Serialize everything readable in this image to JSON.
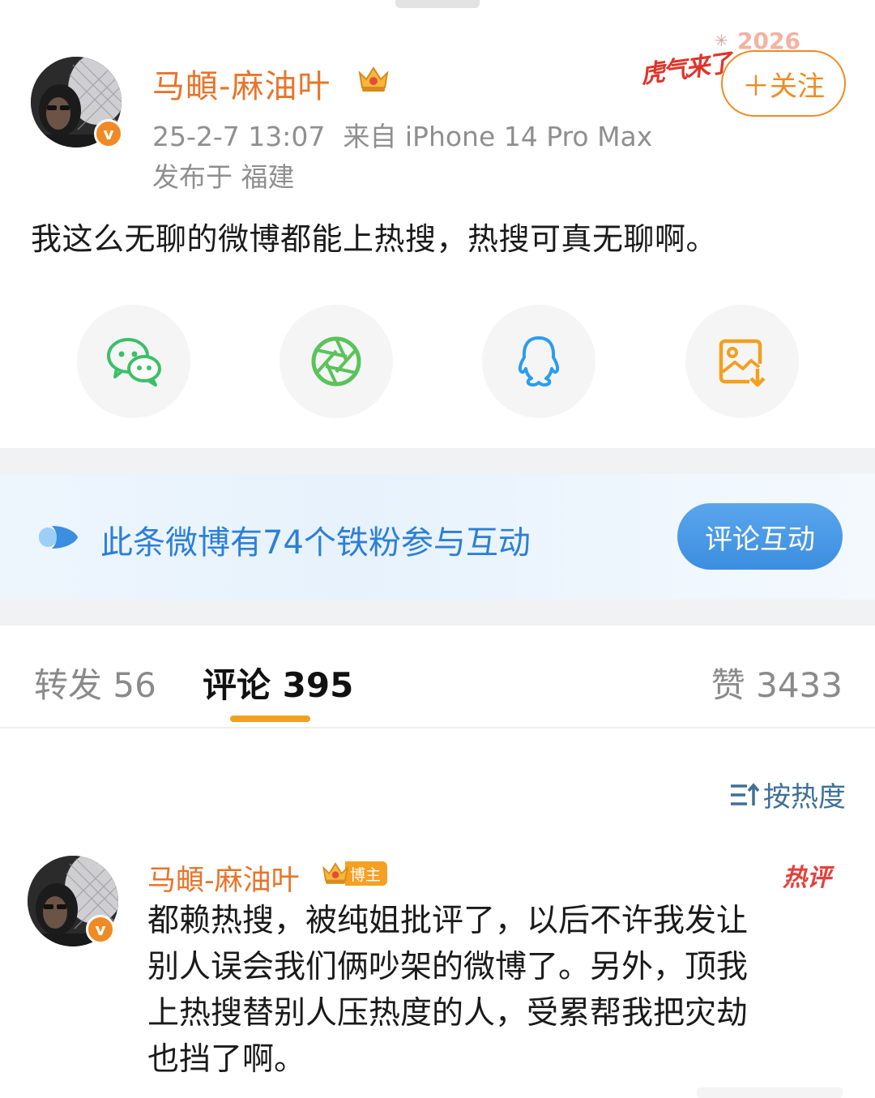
{
  "post": {
    "author_name": "马頔-麻油叶",
    "timestamp": "25-2-7 13:07",
    "source": "来自 iPhone 14 Pro Max",
    "location": "发布于 福建",
    "text": "我这么无聊的微博都能上热搜，热搜可真无聊啊。",
    "stamp": "虎气来了",
    "deco_text": "2026",
    "follow_label": "＋关注"
  },
  "share_buttons": [
    {
      "icon": "wechat-icon",
      "color": "#3cbf6a"
    },
    {
      "icon": "moments-icon",
      "color": "#5ac35a"
    },
    {
      "icon": "qq-icon",
      "color": "#2b9cf2"
    },
    {
      "icon": "save-image-icon",
      "color": "#f2a020"
    }
  ],
  "fans_banner": {
    "text": "此条微博有74个铁粉参与互动",
    "button_label": "评论互动"
  },
  "tabs": {
    "repost": "转发 56",
    "comments": "评论 395",
    "likes": "赞 3433"
  },
  "sort_label": "按热度",
  "comment": {
    "author_name": "马頔-麻油叶",
    "author_tag": "博主",
    "hot_tag": "热评",
    "lines": [
      "都赖热搜，被纯姐批评了，以后不许我发让",
      "别人误会我们俩吵架的微博了。另外，顶我",
      "上热搜替别人压热度的人，受累帮我把灾劫",
      "也挡了啊。"
    ]
  },
  "colors": {
    "accent_orange": "#f08a24",
    "link_blue": "#2d7fd8",
    "tab_indicator": "#f2a020",
    "hot_red": "#e2413d"
  }
}
